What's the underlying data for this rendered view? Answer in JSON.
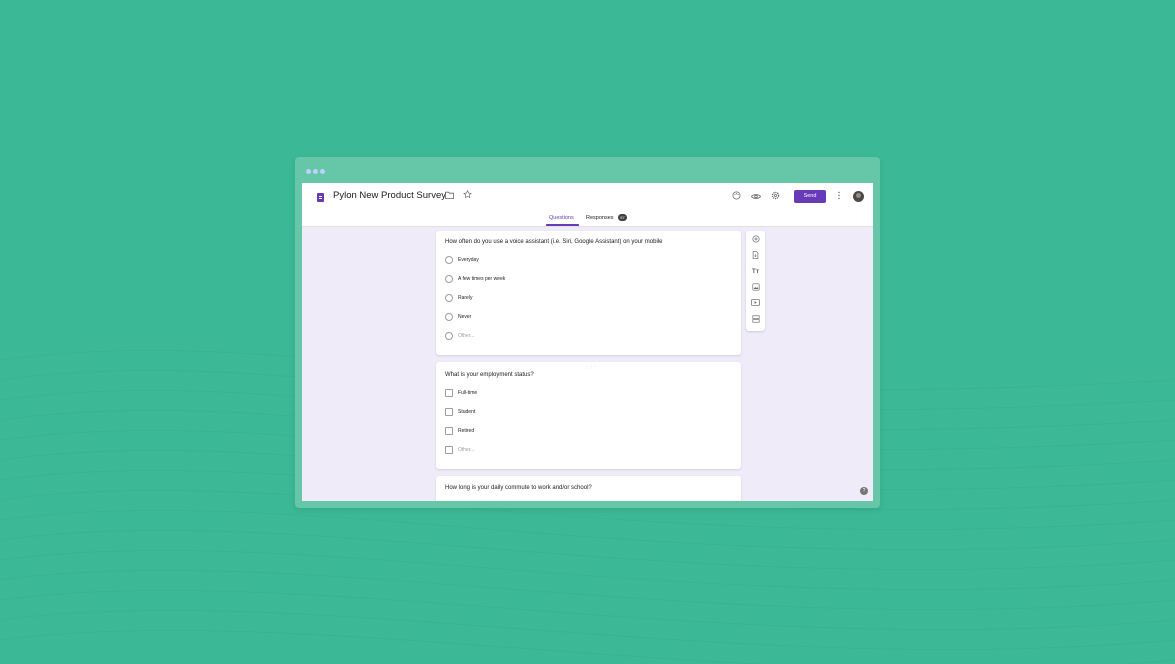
{
  "window": {
    "dot_color": "#b9d3ff"
  },
  "header": {
    "title": "Pylon New Product Survey",
    "send_label": "Send",
    "icons": [
      "form-doc-icon",
      "folder-icon",
      "star-icon",
      "palette-icon",
      "eye-icon",
      "settings-icon",
      "more-vert-icon",
      "avatar"
    ]
  },
  "tabs": [
    {
      "label": "Questions",
      "active": true
    },
    {
      "label": "Responses",
      "badge": "57"
    }
  ],
  "questions": [
    {
      "title": "How often do you use a voice assistant (i.e. Siri, Google Assistant) on your mobile",
      "type": "radio",
      "options": [
        "Everyday",
        "A few times per week",
        "Rarely",
        "Never",
        "Other..."
      ]
    },
    {
      "title": "What is your employment status?",
      "type": "checkbox",
      "options": [
        "Full-time",
        "Student",
        "Retired",
        "Other..."
      ]
    },
    {
      "title": "How long is your daily commute to work and/or school?",
      "type": "text",
      "options": []
    }
  ],
  "toolbar": {
    "tools": [
      "add-question-icon",
      "import-questions-icon",
      "add-title-icon",
      "add-image-icon",
      "add-video-icon",
      "add-section-icon"
    ]
  },
  "help": {
    "label": "?"
  },
  "colors": {
    "accent": "#673ab7",
    "background": "#3bb896",
    "form_bg": "#f0ebf8"
  }
}
